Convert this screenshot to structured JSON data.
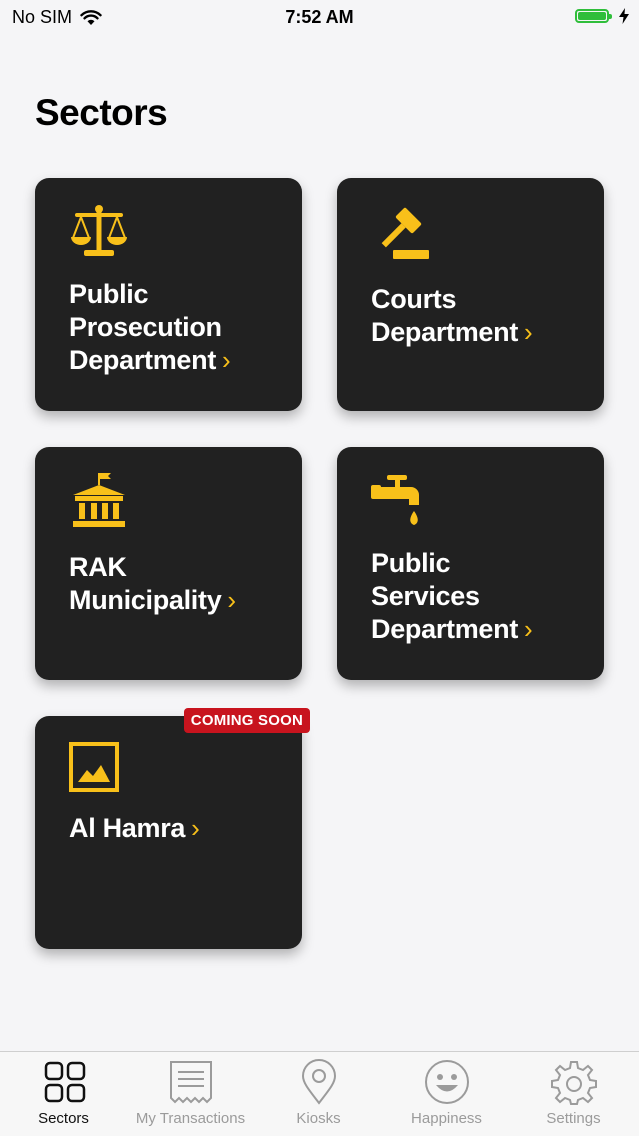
{
  "status": {
    "carrier": "No SIM",
    "time": "7:52 AM"
  },
  "page": {
    "title": "Sectors"
  },
  "sectors": [
    {
      "line1": "Public",
      "line2": "Prosecution",
      "line3": "Department",
      "icon": "scales-icon"
    },
    {
      "line1": "Courts",
      "line2": "Department",
      "icon": "gavel-icon"
    },
    {
      "line1": "RAK",
      "line2": "Municipality",
      "icon": "municipality-building-icon"
    },
    {
      "line1": "Public",
      "line2": "Services",
      "line3": "Department",
      "icon": "water-tap-icon"
    },
    {
      "line1": "Al Hamra",
      "icon": "image-placeholder-icon",
      "badge": "COMING SOON"
    }
  ],
  "chevron": "›",
  "tabs": [
    {
      "label": "Sectors",
      "icon": "grid-icon",
      "active": true
    },
    {
      "label": "My Transactions",
      "icon": "receipt-icon"
    },
    {
      "label": "Kiosks",
      "icon": "location-pin-icon"
    },
    {
      "label": "Happiness",
      "icon": "smiley-icon"
    },
    {
      "label": "Settings",
      "icon": "gear-icon"
    }
  ],
  "colors": {
    "accent": "#F8C01A",
    "card": "#212121",
    "badge": "#C8141E",
    "battery": "#2FBE3B"
  }
}
